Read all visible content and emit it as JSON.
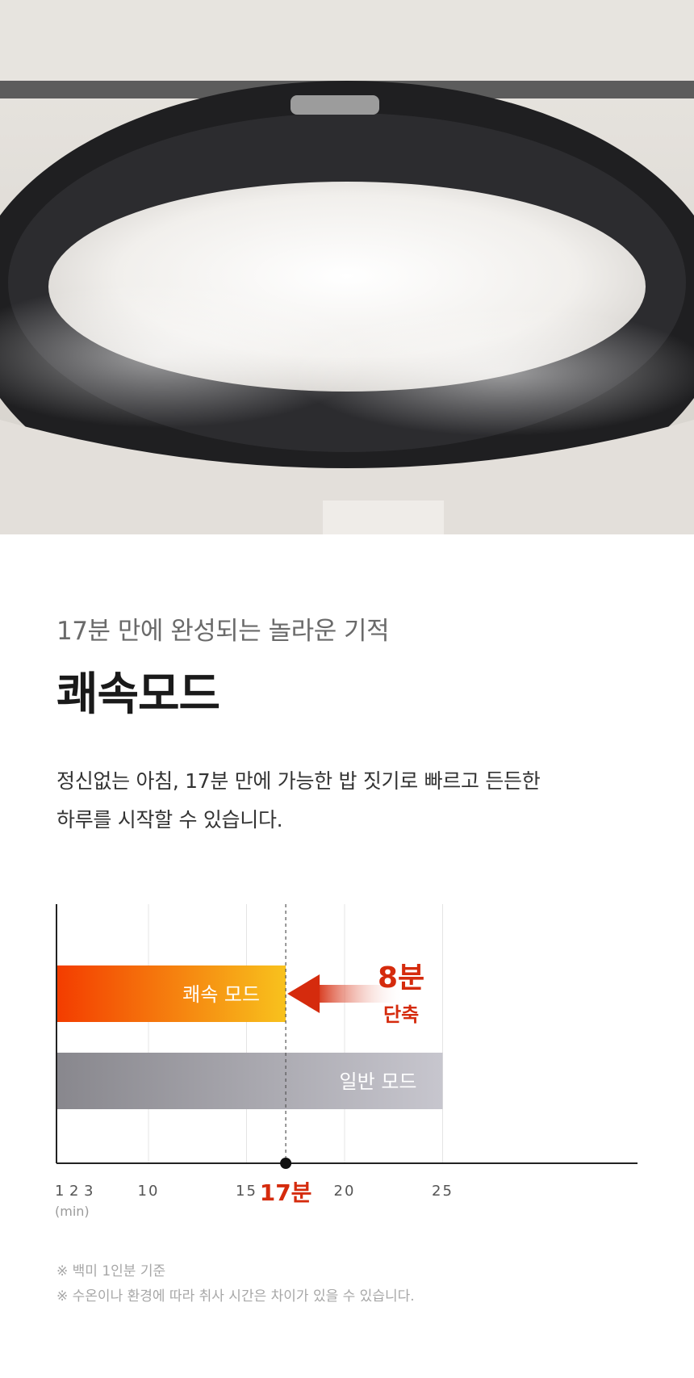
{
  "copy": {
    "subtitle": "17분 만에 완성되는 놀라운 기적",
    "title": "쾌속모드",
    "desc_line1": "정신없는 아침, 17분 만에 가능한 밥 짓기로 빠르고 든든한",
    "desc_line2": "하루를 시작할 수 있습니다."
  },
  "colors": {
    "fast_start": "#f33c00",
    "fast_end": "#f8c21d",
    "normal_start": "#88878d",
    "normal_end": "#c7c6ce",
    "accent": "#d52b0d",
    "axis": "#222222",
    "grid": "#e4e4e4"
  },
  "chart_data": {
    "type": "bar",
    "orientation": "horizontal",
    "unit_label": "(min)",
    "x_ticks": [
      {
        "value": 1,
        "label": "1"
      },
      {
        "value": 2,
        "label": "2"
      },
      {
        "value": 3,
        "label": "3"
      },
      {
        "value": 10,
        "label": "10"
      },
      {
        "value": 15,
        "label": "15"
      },
      {
        "value": 17,
        "label": "17분",
        "highlight": true
      },
      {
        "value": 20,
        "label": "20"
      },
      {
        "value": 25,
        "label": "25"
      }
    ],
    "gridlines": [
      10,
      15,
      20,
      25
    ],
    "series": [
      {
        "name": "쾌속 모드",
        "value": 17
      },
      {
        "name": "일반 모드",
        "value": 25
      }
    ],
    "marker_value": 17,
    "annotation": {
      "amount": "8분",
      "text": "단축"
    }
  },
  "notes": [
    "※ 백미 1인분 기준",
    "※ 수온이나 환경에 따라 취사 시간은 차이가 있을 수 있습니다."
  ]
}
